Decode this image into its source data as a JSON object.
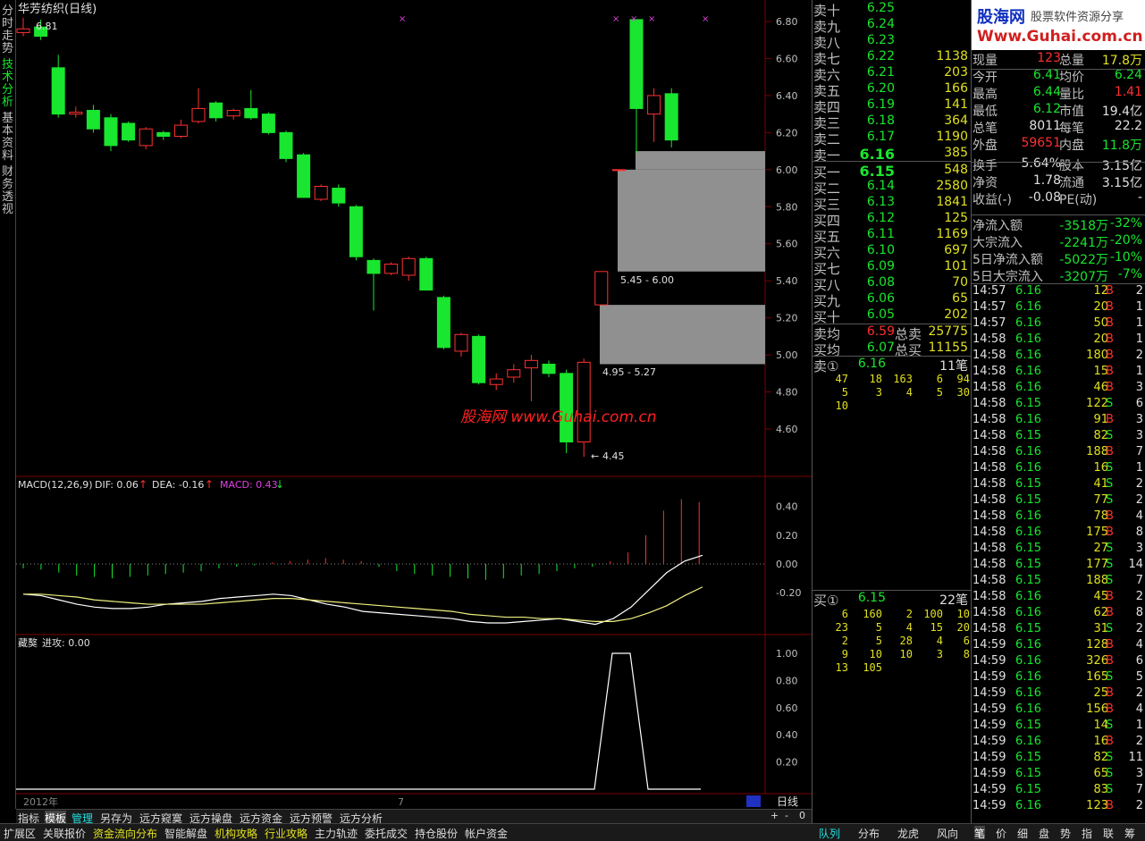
{
  "side_tabs": [
    "分时走势",
    "技术分析",
    "基本资料",
    "财务透视"
  ],
  "chart": {
    "title": "华芳纺织(日线)",
    "high_marker": "6.81",
    "low_marker": "4.45",
    "box1_label": "5.45 - 6.00",
    "box2_label": "4.95 - 5.27",
    "watermark": "股海网  www.Guhai.com.cn",
    "year_label": "2012年",
    "month_label": "7",
    "price_ticks": [
      "6.80",
      "6.60",
      "6.40",
      "6.20",
      "6.00",
      "5.80",
      "5.60",
      "5.40",
      "5.20",
      "5.00",
      "4.80",
      "4.60"
    ],
    "period_label": "日线",
    "zoom_controls": [
      "+",
      "-",
      "0"
    ],
    "candles": [
      {
        "o": 6.74,
        "c": 6.76,
        "h": 6.82,
        "l": 6.72
      },
      {
        "o": 6.77,
        "c": 6.72,
        "h": 6.81,
        "l": 6.7
      },
      {
        "o": 6.55,
        "c": 6.3,
        "h": 6.62,
        "l": 6.28
      },
      {
        "o": 6.3,
        "c": 6.31,
        "h": 6.34,
        "l": 6.28
      },
      {
        "o": 6.32,
        "c": 6.22,
        "h": 6.35,
        "l": 6.2
      },
      {
        "o": 6.28,
        "c": 6.13,
        "h": 6.3,
        "l": 6.1
      },
      {
        "o": 6.25,
        "c": 6.16,
        "h": 6.26,
        "l": 6.15
      },
      {
        "o": 6.13,
        "c": 6.22,
        "h": 6.23,
        "l": 6.11
      },
      {
        "o": 6.2,
        "c": 6.18,
        "h": 6.21,
        "l": 6.16
      },
      {
        "o": 6.18,
        "c": 6.24,
        "h": 6.27,
        "l": 6.17
      },
      {
        "o": 6.26,
        "c": 6.33,
        "h": 6.44,
        "l": 6.25
      },
      {
        "o": 6.36,
        "c": 6.28,
        "h": 6.37,
        "l": 6.26
      },
      {
        "o": 6.29,
        "c": 6.32,
        "h": 6.33,
        "l": 6.27
      },
      {
        "o": 6.33,
        "c": 6.28,
        "h": 6.43,
        "l": 6.27
      },
      {
        "o": 6.3,
        "c": 6.2,
        "h": 6.31,
        "l": 6.19
      },
      {
        "o": 6.2,
        "c": 6.06,
        "h": 6.21,
        "l": 6.04
      },
      {
        "o": 6.08,
        "c": 5.85,
        "h": 6.09,
        "l": 5.85
      },
      {
        "o": 5.84,
        "c": 5.91,
        "h": 5.92,
        "l": 5.83
      },
      {
        "o": 5.9,
        "c": 5.82,
        "h": 5.92,
        "l": 5.8
      },
      {
        "o": 5.8,
        "c": 5.53,
        "h": 5.81,
        "l": 5.51
      },
      {
        "o": 5.51,
        "c": 5.44,
        "h": 5.52,
        "l": 5.24
      },
      {
        "o": 5.44,
        "c": 5.49,
        "h": 5.5,
        "l": 5.43
      },
      {
        "o": 5.43,
        "c": 5.52,
        "h": 5.53,
        "l": 5.4
      },
      {
        "o": 5.52,
        "c": 5.35,
        "h": 5.53,
        "l": 5.35
      },
      {
        "o": 5.31,
        "c": 5.04,
        "h": 5.32,
        "l": 5.03
      },
      {
        "o": 5.02,
        "c": 5.11,
        "h": 5.12,
        "l": 4.99
      },
      {
        "o": 5.1,
        "c": 4.85,
        "h": 5.11,
        "l": 4.84
      },
      {
        "o": 4.84,
        "c": 4.87,
        "h": 4.9,
        "l": 4.81
      },
      {
        "o": 4.88,
        "c": 4.92,
        "h": 4.95,
        "l": 4.85
      },
      {
        "o": 4.93,
        "c": 4.97,
        "h": 5.0,
        "l": 4.75
      },
      {
        "o": 4.95,
        "c": 4.9,
        "h": 4.97,
        "l": 4.88
      },
      {
        "o": 4.9,
        "c": 4.53,
        "h": 4.92,
        "l": 4.47
      },
      {
        "o": 4.53,
        "c": 4.96,
        "h": 4.98,
        "l": 4.45
      },
      {
        "o": 5.27,
        "c": 5.45,
        "h": 5.45,
        "l": 5.27
      },
      {
        "o": 6.0,
        "c": 6.0,
        "h": 6.0,
        "l": 6.0
      },
      {
        "o": 6.81,
        "c": 6.33,
        "h": 6.81,
        "l": 6.09
      },
      {
        "o": 6.3,
        "c": 6.4,
        "h": 6.44,
        "l": 6.15
      },
      {
        "o": 6.41,
        "c": 6.16,
        "h": 6.44,
        "l": 6.12
      }
    ]
  },
  "macd": {
    "title": "MACD(12,26,9)",
    "dif": "DIF: 0.06",
    "dea": "DEA: -0.16",
    "macd": "MACD: 0.43",
    "ticks": [
      "0.40",
      "0.20",
      "0.00",
      "-0.20"
    ]
  },
  "attack": {
    "title": "藏獒",
    "value": "进攻: 0.00",
    "ticks": [
      "1.00",
      "0.80",
      "0.60",
      "0.40",
      "0.20"
    ]
  },
  "orderbook": {
    "asks": [
      {
        "label": "卖十",
        "price": "6.25",
        "vol": ""
      },
      {
        "label": "卖九",
        "price": "6.24",
        "vol": ""
      },
      {
        "label": "卖八",
        "price": "6.23",
        "vol": ""
      },
      {
        "label": "卖七",
        "price": "6.22",
        "vol": "1138"
      },
      {
        "label": "卖六",
        "price": "6.21",
        "vol": "203"
      },
      {
        "label": "卖五",
        "price": "6.20",
        "vol": "166"
      },
      {
        "label": "卖四",
        "price": "6.19",
        "vol": "141"
      },
      {
        "label": "卖三",
        "price": "6.18",
        "vol": "364"
      },
      {
        "label": "卖二",
        "price": "6.17",
        "vol": "1190"
      },
      {
        "label": "卖一",
        "price": "6.16",
        "vol": "385"
      }
    ],
    "bids": [
      {
        "label": "买一",
        "price": "6.15",
        "vol": "548"
      },
      {
        "label": "买二",
        "price": "6.14",
        "vol": "2580"
      },
      {
        "label": "买三",
        "price": "6.13",
        "vol": "1841"
      },
      {
        "label": "买四",
        "price": "6.12",
        "vol": "125"
      },
      {
        "label": "买五",
        "price": "6.11",
        "vol": "1169"
      },
      {
        "label": "买六",
        "price": "6.10",
        "vol": "697"
      },
      {
        "label": "买七",
        "price": "6.09",
        "vol": "101"
      },
      {
        "label": "买八",
        "price": "6.08",
        "vol": "70"
      },
      {
        "label": "买九",
        "price": "6.06",
        "vol": "65"
      },
      {
        "label": "买十",
        "price": "6.05",
        "vol": "202"
      }
    ],
    "ask_avg_label": "卖均",
    "ask_avg": "6.59",
    "total_sell_label": "总卖",
    "total_sell": "25775",
    "bid_avg_label": "买均",
    "bid_avg": "6.07",
    "total_buy_label": "总买",
    "total_buy": "11155",
    "sell1_queue_label": "卖①",
    "sell1_queue_price": "6.16",
    "sell1_queue_count": "11笔",
    "sell1_queue": [
      [
        "47",
        "18",
        "163",
        "6",
        "94"
      ],
      [
        "5",
        "3",
        "4",
        "5",
        "30"
      ],
      [
        "10"
      ]
    ],
    "buy1_queue_label": "买①",
    "buy1_queue_price": "6.15",
    "buy1_queue_count": "22笔",
    "buy1_queue": [
      [
        "6",
        "160",
        "2",
        "100",
        "10"
      ],
      [
        "23",
        "5",
        "4",
        "15",
        "20"
      ],
      [
        "2",
        "5",
        "28",
        "4",
        "6"
      ],
      [
        "9",
        "10",
        "10",
        "3",
        "8"
      ],
      [
        "13",
        "105"
      ]
    ]
  },
  "logo": {
    "title": "股海网",
    "subtitle": "股票软件资源分享",
    "url": "Www.Guhai.com.cn"
  },
  "stats": [
    {
      "l1": "现量",
      "v1": "123",
      "c1": "#ff3030",
      "l2": "总量",
      "v2": "17.8万",
      "c2": "#e0e020"
    },
    {
      "l1": "今开",
      "v1": "6.41",
      "c1": "#19e62e",
      "l2": "均价",
      "v2": "6.24",
      "c2": "#19e62e"
    },
    {
      "l1": "最高",
      "v1": "6.44",
      "c1": "#19e62e",
      "l2": "量比",
      "v2": "1.41",
      "c2": "#ff3030"
    },
    {
      "l1": "最低",
      "v1": "6.12",
      "c1": "#19e62e",
      "l2": "市值",
      "v2": "19.4亿",
      "c2": "#e0e0e0"
    },
    {
      "l1": "总笔",
      "v1": "8011",
      "c1": "#e0e0e0",
      "l2": "每笔",
      "v2": "22.2",
      "c2": "#e0e0e0"
    },
    {
      "l1": "外盘",
      "v1": "59651",
      "c1": "#ff3030",
      "l2": "内盘",
      "v2": "11.8万",
      "c2": "#19e62e"
    },
    {
      "l1": "换手",
      "v1": "5.64%",
      "c1": "#e0e0e0",
      "l2": "股本",
      "v2": "3.15亿",
      "c2": "#e0e0e0"
    },
    {
      "l1": "净资",
      "v1": "1.78",
      "c1": "#e0e0e0",
      "l2": "流通",
      "v2": "3.15亿",
      "c2": "#e0e0e0"
    },
    {
      "l1": "收益(-)",
      "v1": "-0.08",
      "c1": "#e0e0e0",
      "l2": "PE(动)",
      "v2": "-",
      "c2": "#e0e0e0"
    }
  ],
  "flows": [
    {
      "label": "净流入额",
      "v": "-3518万",
      "p": "-32%"
    },
    {
      "label": "大宗流入",
      "v": "-2241万",
      "p": "-20%"
    },
    {
      "label": "5日净流入额",
      "v": "-5022万",
      "p": "-10%"
    },
    {
      "label": "5日大宗流入",
      "v": "-3207万",
      "p": "-7%"
    }
  ],
  "ticks": [
    [
      "14:57",
      "6.16",
      "12",
      "B",
      "2"
    ],
    [
      "14:57",
      "6.16",
      "20",
      "B",
      "1"
    ],
    [
      "14:57",
      "6.16",
      "50",
      "B",
      "1"
    ],
    [
      "14:58",
      "6.16",
      "20",
      "B",
      "1"
    ],
    [
      "14:58",
      "6.16",
      "180",
      "B",
      "2"
    ],
    [
      "14:58",
      "6.16",
      "15",
      "B",
      "1"
    ],
    [
      "14:58",
      "6.16",
      "46",
      "B",
      "3"
    ],
    [
      "14:58",
      "6.15",
      "122",
      "S",
      "6"
    ],
    [
      "14:58",
      "6.16",
      "91",
      "B",
      "3"
    ],
    [
      "14:58",
      "6.15",
      "82",
      "S",
      "3"
    ],
    [
      "14:58",
      "6.16",
      "188",
      "B",
      "7"
    ],
    [
      "14:58",
      "6.16",
      "16",
      "S",
      "1"
    ],
    [
      "14:58",
      "6.15",
      "41",
      "S",
      "2"
    ],
    [
      "14:58",
      "6.15",
      "77",
      "S",
      "2"
    ],
    [
      "14:58",
      "6.16",
      "78",
      "B",
      "4"
    ],
    [
      "14:58",
      "6.16",
      "175",
      "B",
      "8"
    ],
    [
      "14:58",
      "6.15",
      "27",
      "S",
      "3"
    ],
    [
      "14:58",
      "6.15",
      "177",
      "S",
      "14"
    ],
    [
      "14:58",
      "6.15",
      "188",
      "S",
      "7"
    ],
    [
      "14:58",
      "6.16",
      "45",
      "B",
      "2"
    ],
    [
      "14:58",
      "6.16",
      "62",
      "B",
      "8"
    ],
    [
      "14:58",
      "6.15",
      "31",
      "S",
      "2"
    ],
    [
      "14:59",
      "6.16",
      "128",
      "B",
      "4"
    ],
    [
      "14:59",
      "6.16",
      "326",
      "B",
      "6"
    ],
    [
      "14:59",
      "6.16",
      "165",
      "S",
      "5"
    ],
    [
      "14:59",
      "6.16",
      "25",
      "B",
      "2"
    ],
    [
      "14:59",
      "6.16",
      "156",
      "B",
      "4"
    ],
    [
      "14:59",
      "6.15",
      "14",
      "S",
      "1"
    ],
    [
      "14:59",
      "6.16",
      "16",
      "B",
      "2"
    ],
    [
      "14:59",
      "6.15",
      "82",
      "S",
      "11"
    ],
    [
      "14:59",
      "6.15",
      "65",
      "S",
      "3"
    ],
    [
      "14:59",
      "6.15",
      "83",
      "S",
      "7"
    ],
    [
      "14:59",
      "6.16",
      "123",
      "B",
      "2"
    ]
  ],
  "toolbar1": [
    "指标",
    "模板",
    "管理",
    "另存为",
    "远方窥寞",
    "远方操盘",
    "远方资金",
    "远方预警",
    "远方分析"
  ],
  "toolbar2": [
    "扩展区",
    "关联报价",
    "资金流向分布",
    "智能解盘",
    "机构攻略",
    "行业攻略",
    "主力轨迹",
    "委托成交",
    "持仓股份",
    "帐户资金"
  ],
  "right_tabs": [
    "队列",
    "分布",
    "龙虎",
    "风向"
  ],
  "right_small_tabs": [
    "笔",
    "价",
    "细",
    "盘",
    "势",
    "指",
    "联",
    "筹"
  ],
  "colors": {
    "up": "#ff3030",
    "down": "#19e62e",
    "grid": "#7a0000",
    "axis": "#c0c0c0"
  }
}
